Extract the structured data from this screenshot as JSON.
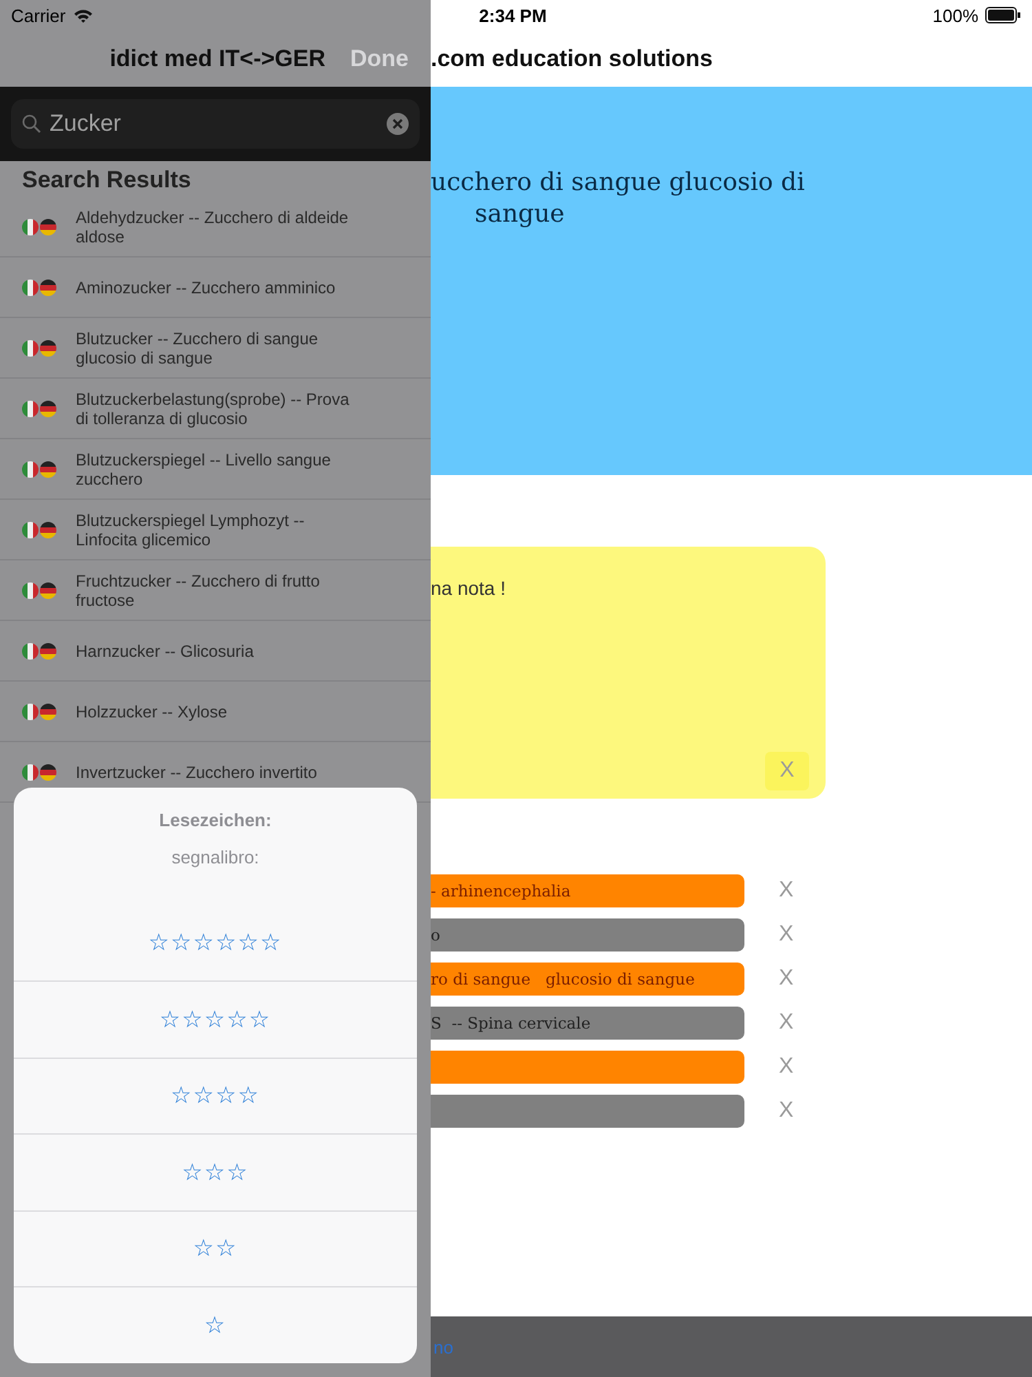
{
  "status_bar": {
    "carrier": "Carrier",
    "time": "2:34 PM",
    "battery": "100%"
  },
  "sidebar": {
    "title": "idict med IT<->GER",
    "done": "Done",
    "search": {
      "value": "Zucker"
    },
    "section": "Search Results",
    "results": [
      {
        "text": "Aldehydzucker  -- Zucchero di aldeide   aldose"
      },
      {
        "text": "Aminozucker  -- Zucchero amminico"
      },
      {
        "text": "Blutzucker  -- Zucchero di sangue glucosio di sangue"
      },
      {
        "text": "Blutzuckerbelastung(sprobe)  -- Prova di tolleranza di glucosio"
      },
      {
        "text": "Blutzuckerspiegel  -- Livello sangue zucchero"
      },
      {
        "text": "Blutzuckerspiegel Lymphozyt  -- Linfocita glicemico"
      },
      {
        "text": "Fruchtzucker  -- Zucchero di frutto   fructose"
      },
      {
        "text": "Harnzucker  -- Glicosuria"
      },
      {
        "text": "Holzzucker  -- Xylose"
      },
      {
        "text": "Invertzucker  -- Zucchero invertito"
      }
    ]
  },
  "main": {
    "title": ".com education solutions",
    "entry_lines": [
      "ucchero di sangue   glucosio di",
      "sangue"
    ],
    "note": {
      "text": "na nota !",
      "close": "X"
    },
    "bookmarks": [
      {
        "text": "- arhinencephalia",
        "color": "#ff8400",
        "close": "X"
      },
      {
        "text": "o",
        "color": "#808080",
        "close": "X"
      },
      {
        "text": "ro di sangue   glucosio di sangue",
        "color": "#ff8400",
        "close": "X"
      },
      {
        "text": "S  -- Spina cervicale",
        "color": "#808080",
        "close": "X"
      },
      {
        "color": "#ff8400",
        "close": "X"
      },
      {
        "color": "#808080",
        "close": "X"
      }
    ],
    "toolbar_link": "no"
  },
  "action_sheet": {
    "title": "Lesezeichen:",
    "subtitle": "segnalibro:",
    "options": [
      "☆☆☆☆☆☆",
      "☆☆☆☆☆",
      "☆☆☆☆",
      "☆☆☆",
      "☆☆",
      "☆"
    ]
  }
}
